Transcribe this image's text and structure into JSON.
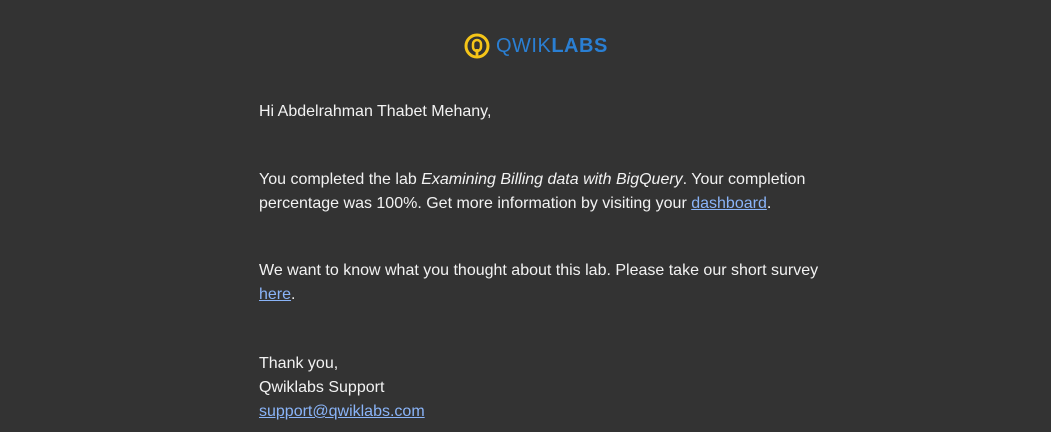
{
  "logo": {
    "text_light": "QWIK",
    "text_bold": "LABS",
    "icon": "qwiklabs-logo-icon",
    "colors": {
      "ring": "#f5c518",
      "wordmark": "#2a7fd3"
    }
  },
  "email": {
    "greeting": "Hi Abdelrahman Thabet Mehany,",
    "completed": {
      "prefix": "You completed the lab ",
      "lab_name": "Examining Billing data with BigQuery",
      "middle": ". Your completion percentage was 100%. Get more information by visiting your ",
      "link_label": "dashboard",
      "suffix": "."
    },
    "survey": {
      "prefix": "We want to know what you thought about this lab. Please take our short survey ",
      "link_label": "here",
      "suffix": "."
    },
    "signoff": {
      "thanks": "Thank you,",
      "team": "Qwiklabs Support",
      "email_link": "support@qwiklabs.com"
    }
  },
  "colors": {
    "background": "#333333",
    "text": "#f2f2f2",
    "link": "#8ab4f8"
  }
}
